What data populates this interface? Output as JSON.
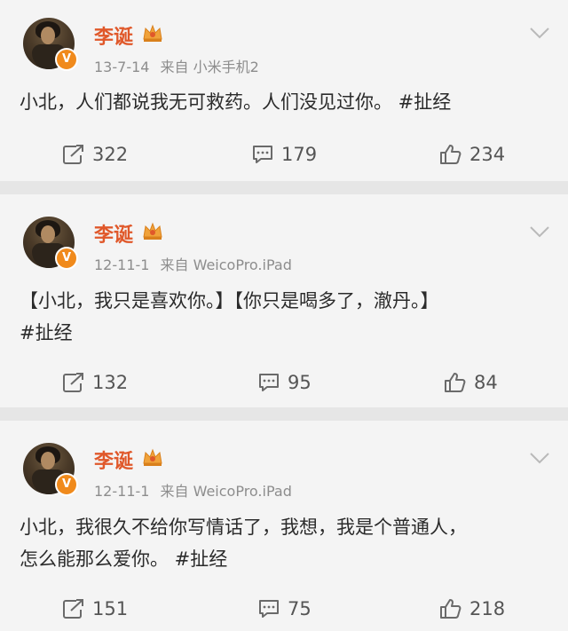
{
  "posts": [
    {
      "author": "李诞",
      "verified_badge": "V",
      "date": "13-7-14",
      "source_prefix": "来自",
      "source": "小米手机2",
      "text_lines": [
        "小北，人们都说我无可救药。人们没见过你。 #扯经"
      ],
      "reposts": "322",
      "comments": "179",
      "likes": "234"
    },
    {
      "author": "李诞",
      "verified_badge": "V",
      "date": "12-11-1",
      "source_prefix": "来自",
      "source": "WeicoPro.iPad",
      "text_lines": [
        "【小北，我只是喜欢你。】【你只是喝多了，澈丹。】",
        "#扯经"
      ],
      "reposts": "132",
      "comments": "95",
      "likes": "84"
    },
    {
      "author": "李诞",
      "verified_badge": "V",
      "date": "12-11-1",
      "source_prefix": "来自",
      "source": "WeicoPro.iPad",
      "text_lines": [
        "小北，我很久不给你写情话了，我想，我是个普通人，",
        "怎么能那么爱你。 #扯经"
      ],
      "reposts": "151",
      "comments": "75",
      "likes": "218"
    }
  ],
  "icons": {
    "repost": "repost-icon",
    "comment": "comment-icon",
    "like": "like-icon",
    "more": "chevron-down-icon",
    "vip": "vip-crown-icon"
  },
  "colors": {
    "author_name": "#e0582a",
    "verified_badge": "#f08a1c",
    "meta_text": "#8d8d8d",
    "body_text": "#2b2b2b",
    "card_bg": "#f4f4f4",
    "separator_bg": "#e6e6e6"
  }
}
